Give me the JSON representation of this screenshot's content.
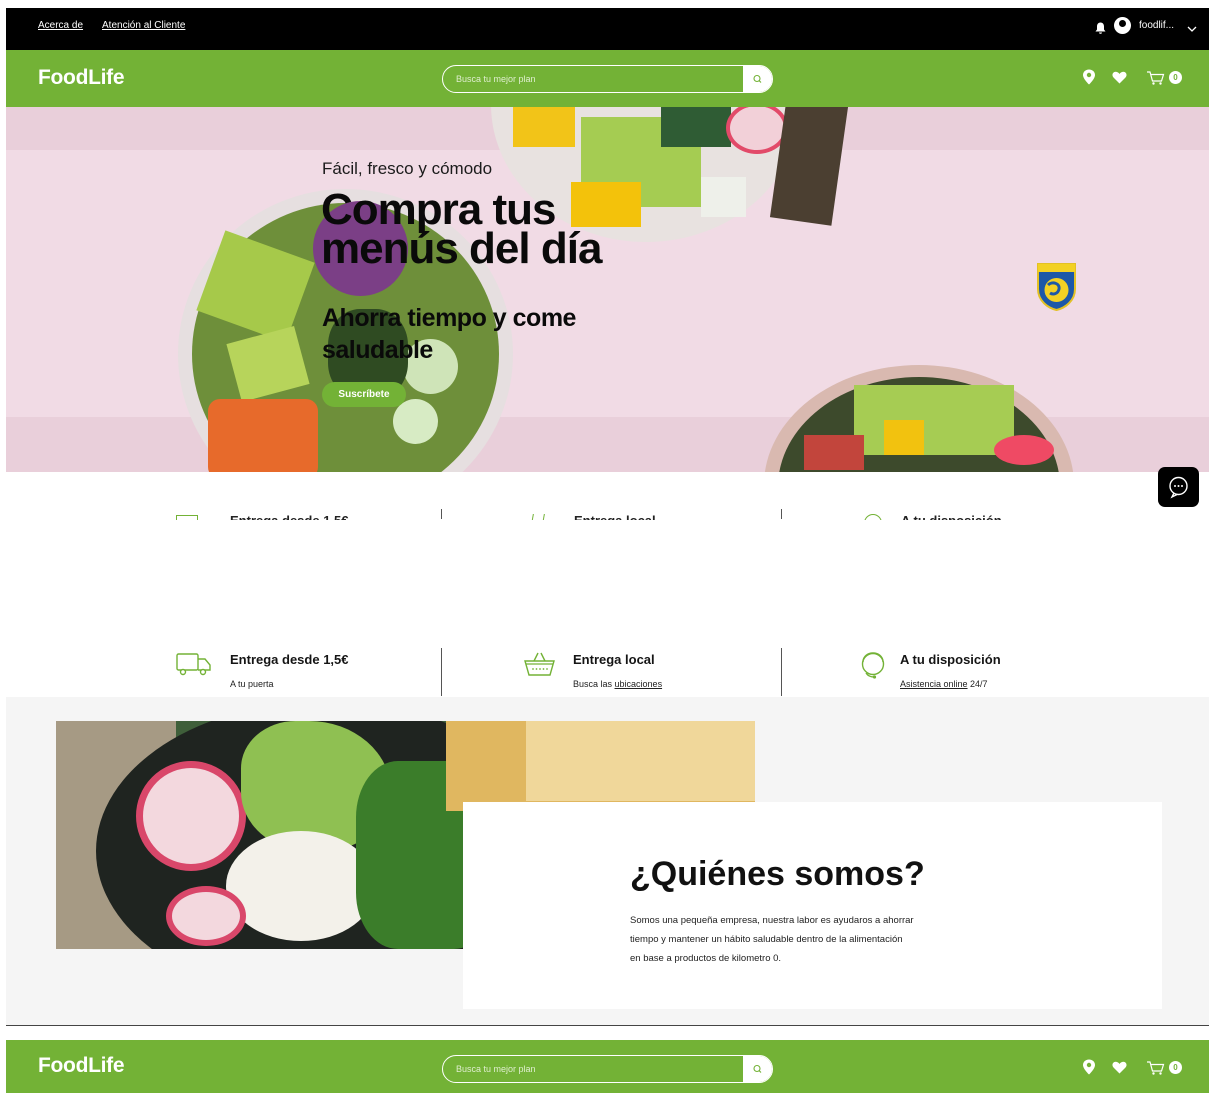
{
  "topbar": {
    "links": [
      "Acerca de",
      "Atención al Cliente"
    ],
    "user_name": "foodlif..."
  },
  "header": {
    "logo": "FoodLife",
    "search_placeholder": "Busca tu mejor plan",
    "cart_count": "0"
  },
  "hero": {
    "tagline": "Fácil, fresco y cómodo",
    "title": "Compra tus menús del día",
    "subtitle": "Ahorra tiempo y come saludable",
    "cta": "Suscríbete"
  },
  "features": [
    {
      "title": "Entrega desde 1,5€",
      "desc_before": "A tu puerta",
      "link": "",
      "desc_after": ""
    },
    {
      "title": "Entrega local",
      "desc_before": "Busca las ",
      "link": "ubicaciones",
      "desc_after": ""
    },
    {
      "title": "A tu disposición",
      "desc_before": "",
      "link": "Asistencia online",
      "desc_after": " 24/7"
    }
  ],
  "about": {
    "title": "¿Quiénes somos?",
    "text": "Somos una pequeña empresa, nuestra labor es ayudaros a ahorrar tiempo y mantener un hábito saludable dentro de la alimentación en base a productos de kilometro 0."
  },
  "colors": {
    "brand_green": "#73b236",
    "topbar": "#000000",
    "hero_bg": "#f1dbe5"
  },
  "icons": [
    "bell-icon",
    "user-avatar-icon",
    "chevron-down-icon",
    "search-icon",
    "location-pin-icon",
    "heart-icon",
    "cart-icon",
    "chat-icon",
    "truck-icon",
    "basket-icon",
    "headset-icon",
    "we-stand-badge"
  ]
}
